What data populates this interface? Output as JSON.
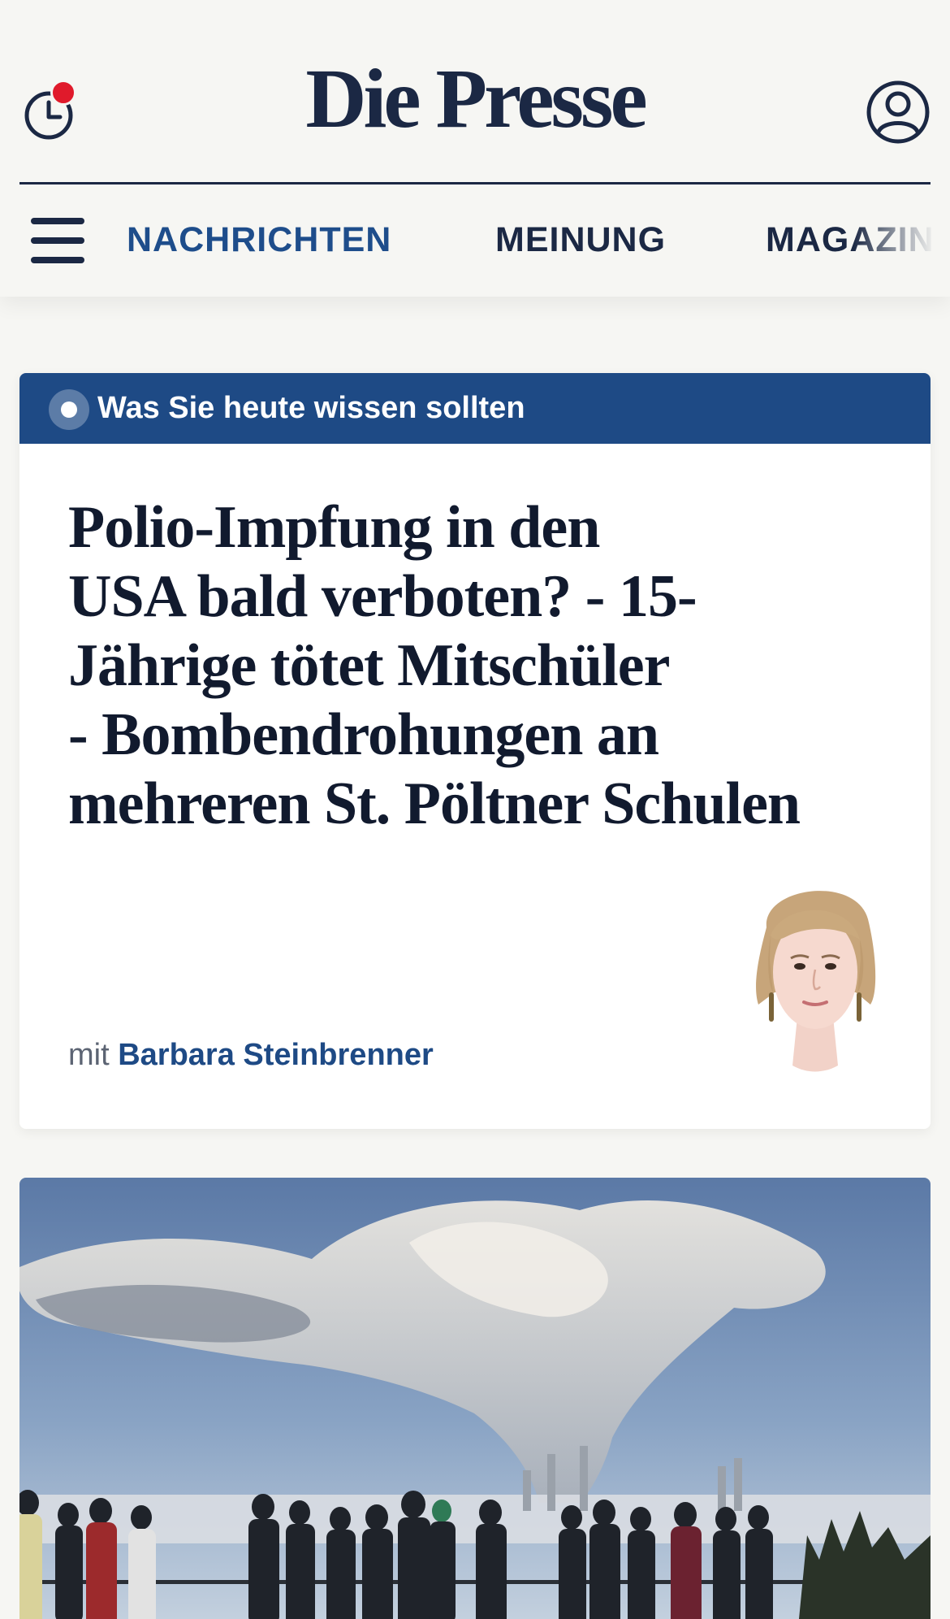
{
  "header": {
    "logo_text": "Die Presse",
    "history_icon": "clock-history-icon",
    "notification_color": "#e01a2b",
    "account_icon": "user-account-icon"
  },
  "nav": {
    "menu_icon": "hamburger-menu-icon",
    "items": [
      {
        "label": "NACHRICHTEN",
        "active": true
      },
      {
        "label": "MEINUNG",
        "active": false
      },
      {
        "label": "MAGAZIN",
        "active": false
      }
    ]
  },
  "briefing": {
    "banner_label": "Was Sie heute wissen sollten",
    "banner_color": "#1e4a85",
    "headline_lines": [
      "Polio-Impfung in den",
      "USA bald verboten? - 15-",
      "Jährige tötet Mitschüler",
      "- Bombendrohungen an",
      "mehreren St. Pöltner Schulen"
    ],
    "author_prefix": "mit",
    "author_name": "Barbara Steinbrenner"
  },
  "lead_article": {
    "image_icon": "power-plant-smoke-photo"
  },
  "colors": {
    "background": "#f6f6f3",
    "brand_navy": "#1b2844",
    "accent_blue": "#1e4d8b"
  }
}
